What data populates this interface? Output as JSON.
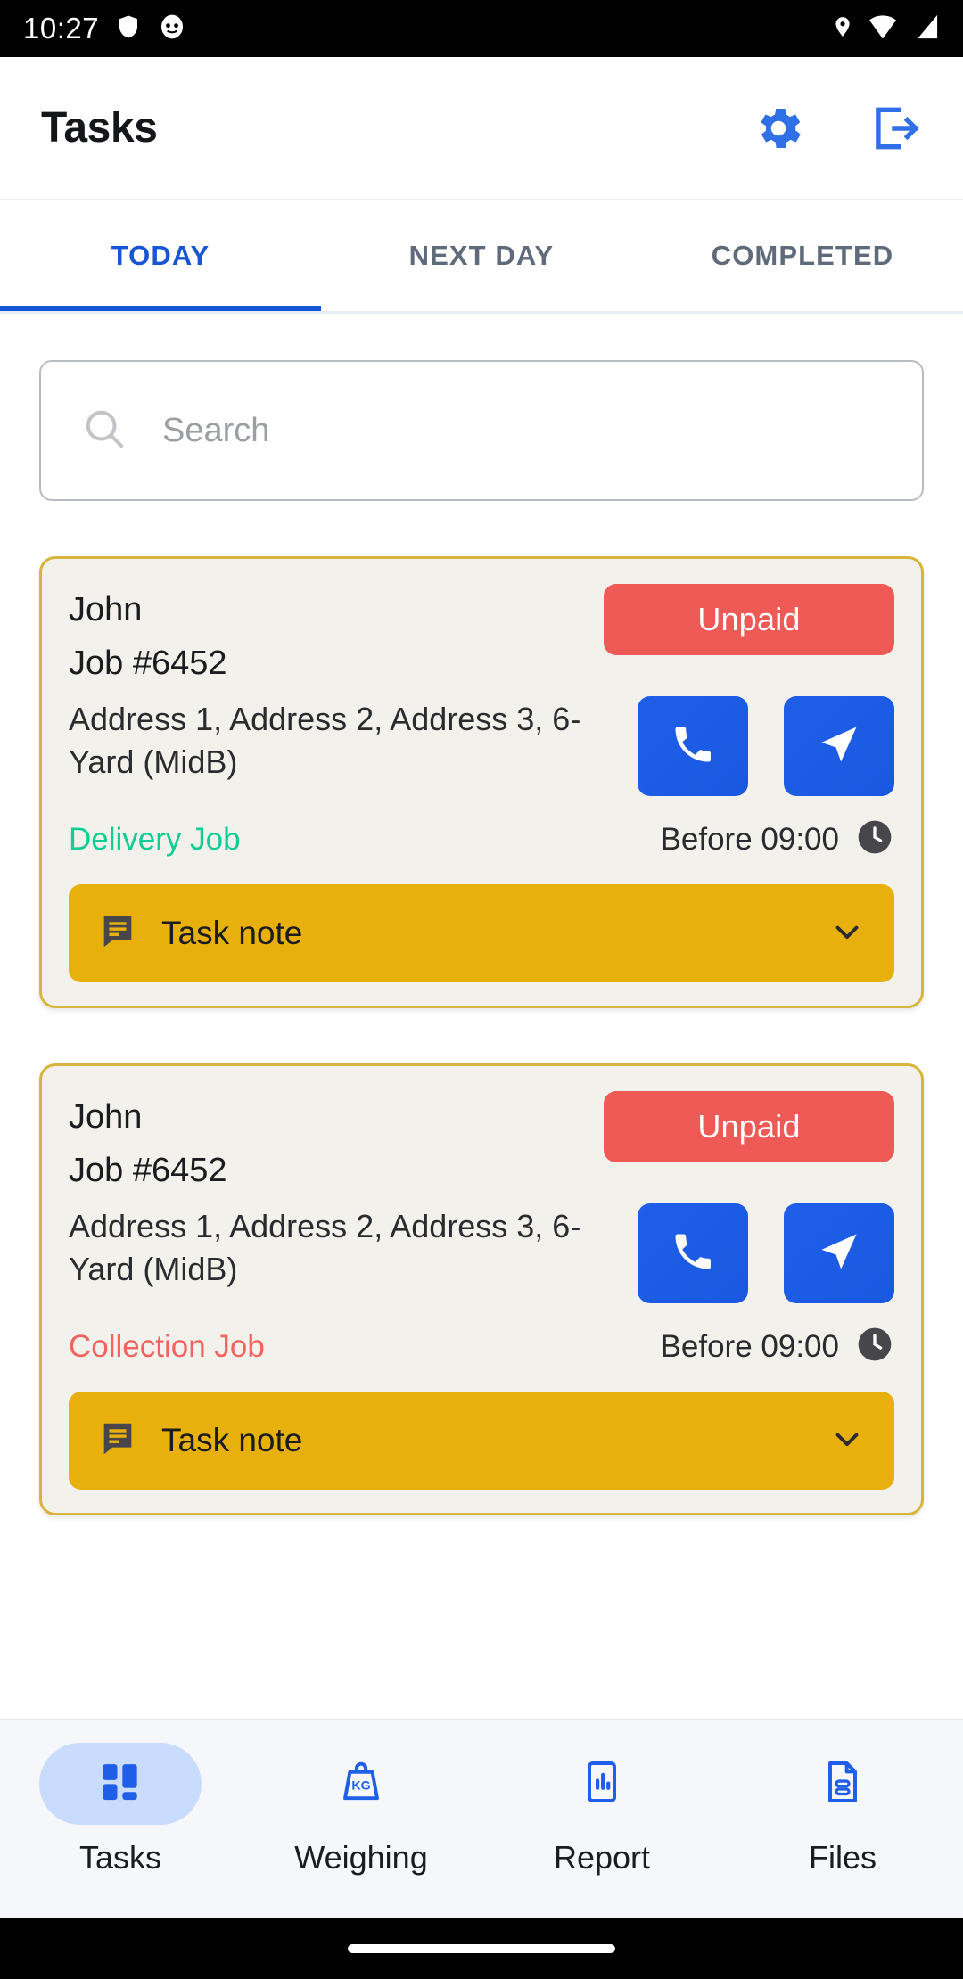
{
  "statusbar": {
    "time": "10:27",
    "left_icons": [
      "shield-icon",
      "app-face-icon"
    ],
    "right_icons": [
      "location-pin-icon",
      "wifi-icon",
      "cellular-signal-icon"
    ]
  },
  "appbar": {
    "title": "Tasks",
    "settings_icon": "gear-icon",
    "logout_icon": "logout-icon",
    "accent_color": "#2f6fe8"
  },
  "tabs": {
    "items": [
      {
        "label": "TODAY",
        "active": true
      },
      {
        "label": "NEXT DAY",
        "active": false
      },
      {
        "label": "COMPLETED",
        "active": false
      }
    ],
    "active_color": "#1656d4",
    "inactive_color": "#5f6b7a"
  },
  "search": {
    "placeholder": "Search",
    "value": "",
    "icon": "search-icon"
  },
  "tasks": [
    {
      "customer": "John",
      "job_number": "Job #6452",
      "address": "Address 1, Address 2, Address 3, 6-Yard (MidB)",
      "payment_status": "Unpaid",
      "payment_status_color": "#ef5a56",
      "job_type": "Delivery Job",
      "job_type_color": "#0fce95",
      "due": "Before 09:00",
      "note_label": "Task note",
      "note_color": "#e8b00c",
      "call_icon": "phone-icon",
      "navigate_icon": "navigate-icon",
      "clock_icon": "clock-icon",
      "note_icon": "note-bubble-icon",
      "expand_icon": "chevron-down-icon"
    },
    {
      "customer": "John",
      "job_number": "Job #6452",
      "address": "Address 1, Address 2, Address 3, 6-Yard (MidB)",
      "payment_status": "Unpaid",
      "payment_status_color": "#ef5a56",
      "job_type": "Collection Job",
      "job_type_color": "#f2635e",
      "due": "Before 09:00",
      "note_label": "Task note",
      "note_color": "#e8b00c",
      "call_icon": "phone-icon",
      "navigate_icon": "navigate-icon",
      "clock_icon": "clock-icon",
      "note_icon": "note-bubble-icon",
      "expand_icon": "chevron-down-icon"
    }
  ],
  "bottomnav": {
    "items": [
      {
        "label": "Tasks",
        "icon": "dashboard-grid-icon",
        "active": true
      },
      {
        "label": "Weighing",
        "icon": "kg-weight-icon",
        "active": false
      },
      {
        "label": "Report",
        "icon": "report-chart-icon",
        "active": false
      },
      {
        "label": "Files",
        "icon": "file-document-icon",
        "active": false
      }
    ],
    "active_pill_color": "#c9dcfd",
    "icon_color": "#1f5fe8"
  }
}
